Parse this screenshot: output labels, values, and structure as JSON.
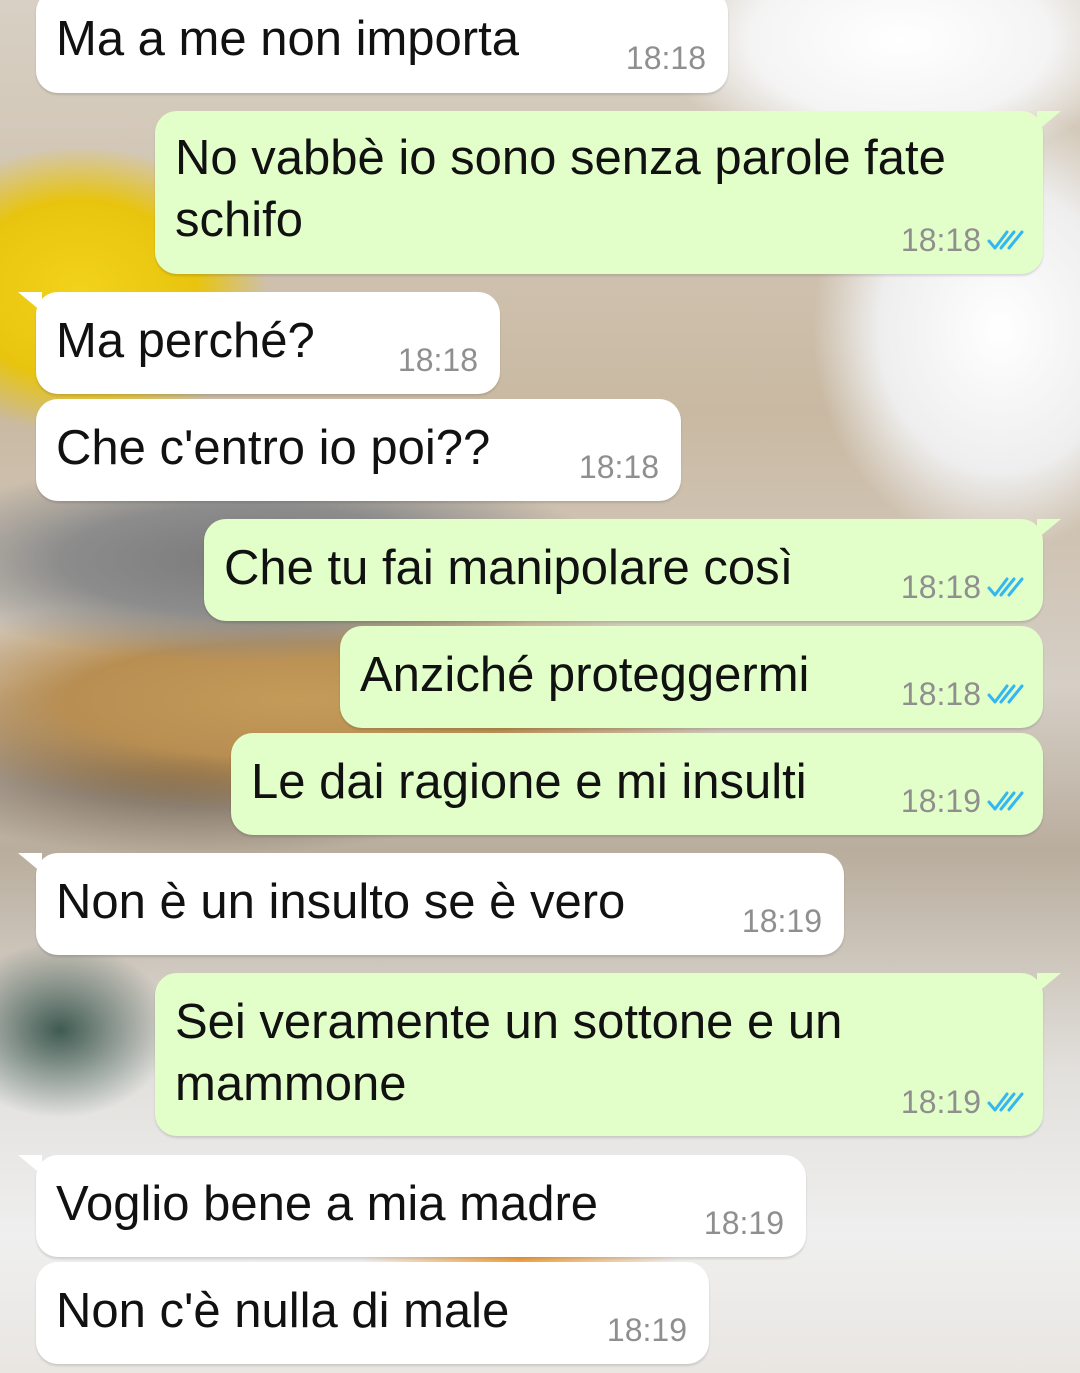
{
  "messages": [
    {
      "direction": "incoming",
      "text": "Ma a me non importa",
      "time": "18:18"
    },
    {
      "direction": "outgoing",
      "lines": [
        "No vabbè io sono senza parole fate",
        "schifo"
      ],
      "time": "18:18",
      "status": "read"
    },
    {
      "direction": "incoming",
      "text": "Ma perché?",
      "time": "18:18"
    },
    {
      "direction": "incoming",
      "text": "Che c'entro io poi??",
      "time": "18:18"
    },
    {
      "direction": "outgoing",
      "text": "Che tu fai manipolare così",
      "time": "18:18",
      "status": "read"
    },
    {
      "direction": "outgoing",
      "text": "Anziché proteggermi",
      "time": "18:18",
      "status": "read"
    },
    {
      "direction": "outgoing",
      "text": "Le dai ragione e mi insulti",
      "time": "18:19",
      "status": "read"
    },
    {
      "direction": "incoming",
      "text": "Non è un insulto se è vero",
      "time": "18:19"
    },
    {
      "direction": "outgoing",
      "lines": [
        "Sei veramente un sottone e un",
        "mammone"
      ],
      "time": "18:19",
      "status": "read"
    },
    {
      "direction": "incoming",
      "text": "Voglio bene a mia madre",
      "time": "18:19"
    },
    {
      "direction": "incoming",
      "text": "Non c'è nulla di male",
      "time": "18:19"
    }
  ],
  "colors": {
    "incoming_bubble": "#ffffff",
    "outgoing_bubble": "#e2ffc9",
    "timestamp": "#8f8f8f",
    "read_ticks": "#34b7f1"
  },
  "icons": {
    "read_receipt": "double-check-icon"
  }
}
